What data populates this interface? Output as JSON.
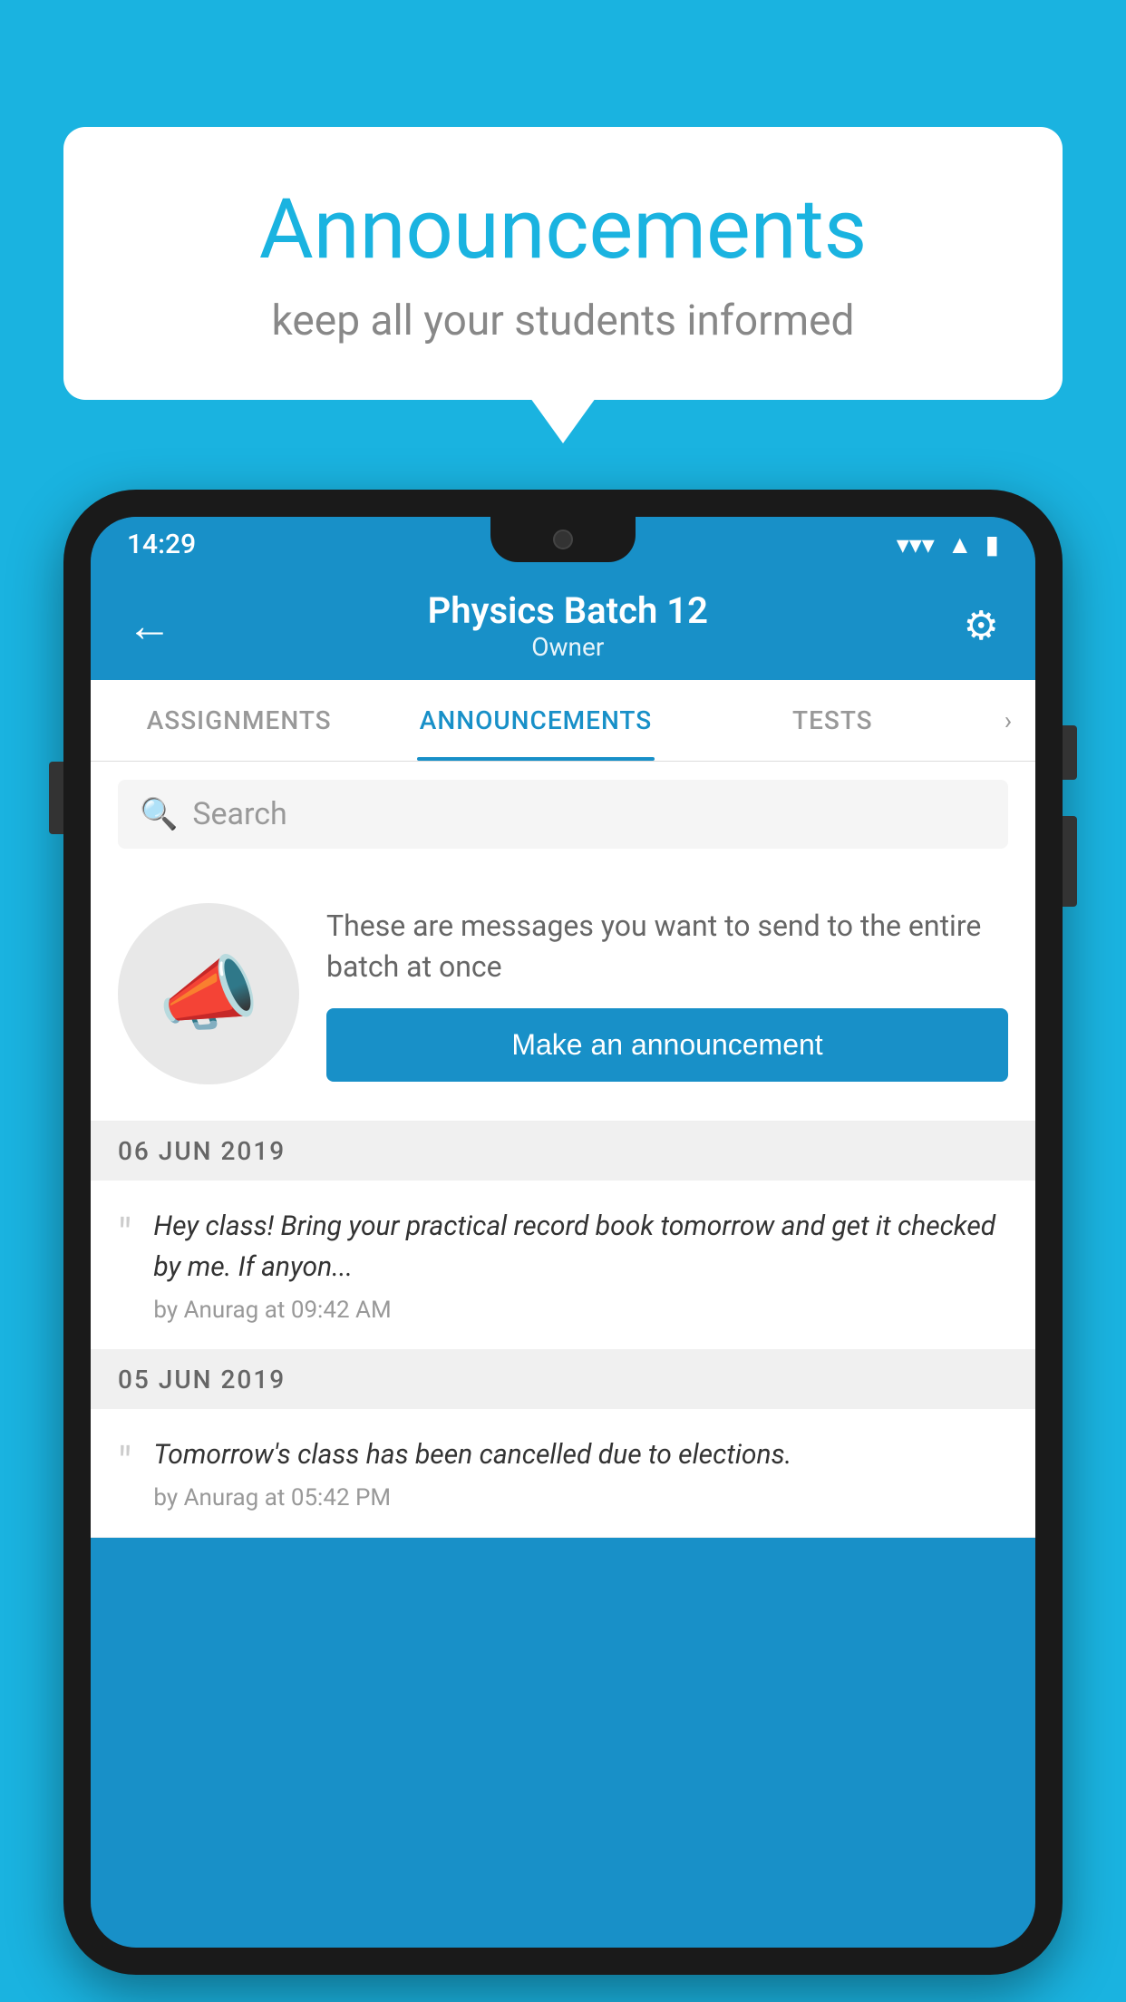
{
  "background_color": "#1ab3e0",
  "speech_bubble": {
    "title": "Announcements",
    "subtitle": "keep all your students informed"
  },
  "phone": {
    "status_bar": {
      "time": "14:29",
      "icons": [
        "wifi",
        "signal",
        "battery"
      ]
    },
    "app_bar": {
      "back_icon": "←",
      "title": "Physics Batch 12",
      "role": "Owner",
      "settings_icon": "⚙"
    },
    "tabs": [
      {
        "label": "ASSIGNMENTS",
        "active": false
      },
      {
        "label": "ANNOUNCEMENTS",
        "active": true
      },
      {
        "label": "TESTS",
        "active": false
      }
    ],
    "search": {
      "placeholder": "Search"
    },
    "promo": {
      "icon": "📣",
      "description": "These are messages you want to send to the entire batch at once",
      "button_label": "Make an announcement"
    },
    "announcements": [
      {
        "date": "06  JUN  2019",
        "text": "Hey class! Bring your practical record book tomorrow and get it checked by me. If anyon...",
        "meta": "by Anurag at 09:42 AM"
      },
      {
        "date": "05  JUN  2019",
        "text": "Tomorrow's class has been cancelled due to elections.",
        "meta": "by Anurag at 05:42 PM"
      }
    ]
  }
}
